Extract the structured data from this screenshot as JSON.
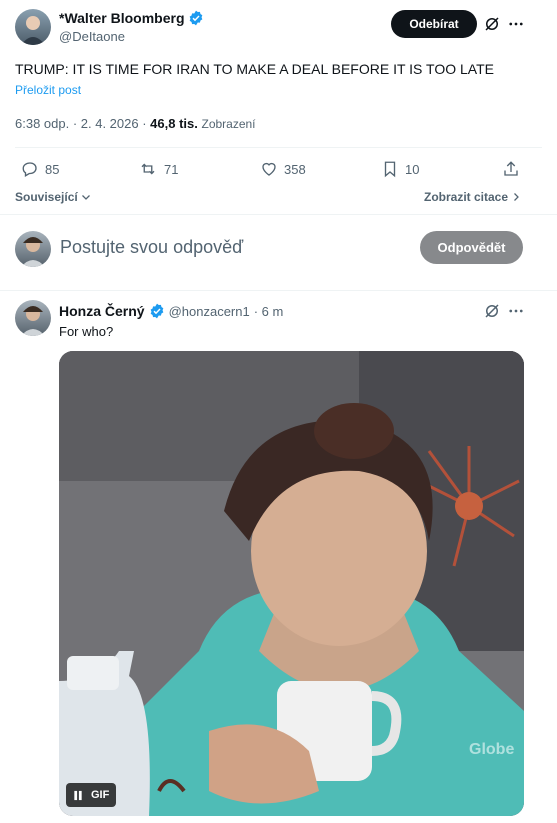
{
  "post": {
    "author_name": "*Walter Bloomberg",
    "author_handle": "@DeItaone",
    "follow_label": "Odebírat",
    "text": "TRUMP: IT IS TIME FOR IRAN TO MAKE A DEAL BEFORE IT IS TOO LATE",
    "translate_label": "Přeložit post",
    "time": "6:38 odp. · 2. 4. 2026 · ",
    "views_count": "46,8 tis.",
    "views_label": "Zobrazení",
    "stats": {
      "replies": "85",
      "reposts": "71",
      "likes": "358",
      "bookmarks": "10"
    },
    "related_label": "Související",
    "quotes_label": "Zobrazit citace"
  },
  "composer": {
    "placeholder": "Postujte svou odpověď",
    "reply_button": "Odpovědět"
  },
  "reply": {
    "author_name": "Honza Černý",
    "author_handle": "@honzacern1",
    "time": "· 6 m",
    "text": "For who?",
    "gif_label": "GIF",
    "watermark": "Globe"
  },
  "colors": {
    "accent": "#1d9bf0",
    "muted": "#536471",
    "follow_bg": "#0f1419"
  }
}
